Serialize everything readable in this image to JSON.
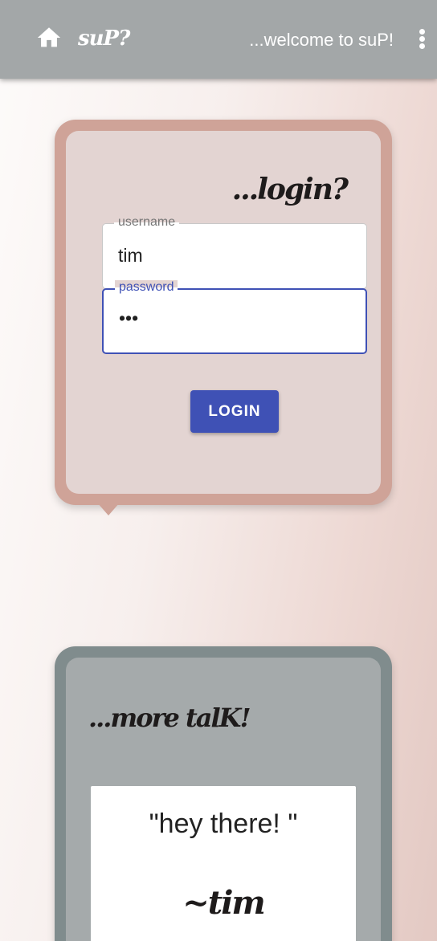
{
  "appbar": {
    "home_icon": "home-icon",
    "brand": "suP?",
    "welcome": "...welcome to suP!",
    "menu_icon": "more-vert-icon",
    "bg_color": "#a3a7a8"
  },
  "login": {
    "title": "...login?",
    "username": {
      "label": "username",
      "value": "tim"
    },
    "password": {
      "label": "password",
      "value": "•••"
    },
    "button_label": "LOGIN",
    "accent_color": "#3f51b5"
  },
  "talk": {
    "title": "...more talK!",
    "quote": "\"hey there! \"",
    "author": "~tim"
  }
}
